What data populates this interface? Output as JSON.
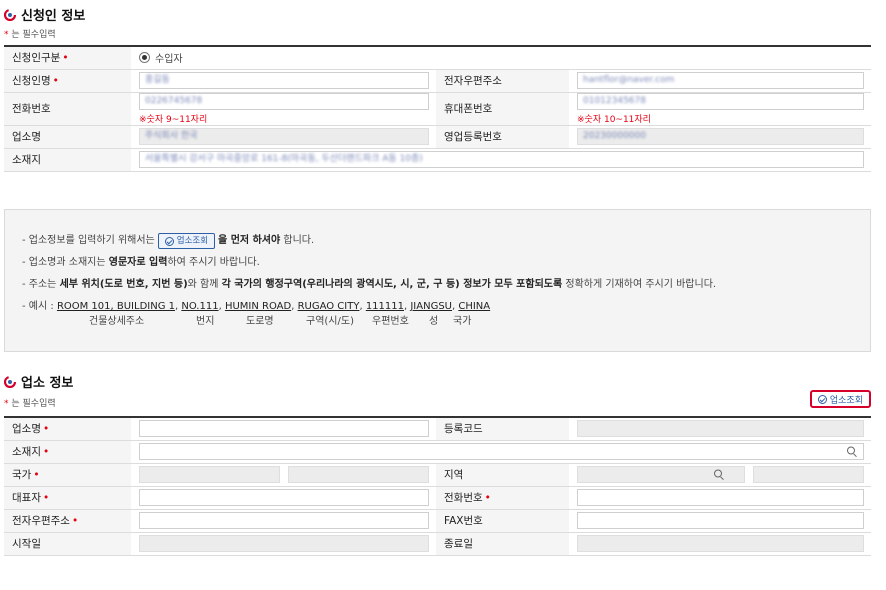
{
  "applicant": {
    "title": "신청인 정보",
    "req_note": "는 필수입력",
    "rows": {
      "type_label": "신청인구분",
      "type_value": "수입자",
      "name_label": "신청인명",
      "name_value": "홍길동",
      "email_label": "전자우편주소",
      "email_value": "hantflor@naver.com",
      "phone_label": "전화번호",
      "phone_value": "0226745678",
      "phone_hint": "※숫자 9~11자리",
      "mobile_label": "휴대폰번호",
      "mobile_value": "01012345678",
      "mobile_hint": "※숫자 10~11자리",
      "biz_label": "업소명",
      "biz_value": "주식회사 한국",
      "biz_reg_label": "영업등록번호",
      "biz_reg_value": "20230000000",
      "addr_label": "소재지",
      "addr_value": "서울특별시 강서구 마곡중앙로 161-8(마곡동, 두산더랜드파크 A동 10층)"
    }
  },
  "notice": {
    "l1_pre": "- 업소정보를 입력하기 위해서는",
    "l1_btn": "업소조회",
    "l1_bold": "을 먼저 하셔야",
    "l1_post": "합니다.",
    "l2_pre": "- 업소명과 소재지는",
    "l2_bold": "영문자로 입력",
    "l2_post": "하여 주시기 바랍니다.",
    "l3_pre": "- 주소는",
    "l3_bold1": "세부 위치(도로 번호, 지번 등)",
    "l3_mid": "와 함께",
    "l3_bold2": "각 국가의 행정구역(우리나라의 광역시도, 시, 군, 구 등) 정보가 모두 포함되도록",
    "l3_post": "정확하게 기재하여 주시기 바랍니다.",
    "l4_pre": "- 예시 :",
    "ex1": "ROOM 101, BUILDING 1",
    "ex2": "NO.111",
    "ex3": "HUMIN ROAD",
    "ex4": "RUGAO CITY",
    "ex5": "111111",
    "ex6": "JIANGSU",
    "ex7": "CHINA",
    "sub1": "건물상세주소",
    "sub2": "번지",
    "sub3": "도로명",
    "sub4": "구역(시/도)",
    "sub5": "우편번호",
    "sub6": "성",
    "sub7": "국가"
  },
  "business": {
    "title": "업소 정보",
    "req_note": "는 필수입력",
    "lookup_btn": "업소조회",
    "rows": {
      "name_label": "업소명",
      "code_label": "등록코드",
      "addr_label": "소재지",
      "country_label": "국가",
      "region_label": "지역",
      "rep_label": "대표자",
      "tel_label": "전화번호",
      "email_label": "전자우편주소",
      "fax_label": "FAX번호",
      "start_label": "시작일",
      "end_label": "종료일"
    }
  },
  "colors": {
    "required": "#e60012",
    "accent": "#2c5fa6",
    "highlight_border": "#d6002a"
  },
  "icons": [
    "section-logo-icon",
    "radio-checked-icon",
    "check-circle-icon",
    "search-icon"
  ]
}
